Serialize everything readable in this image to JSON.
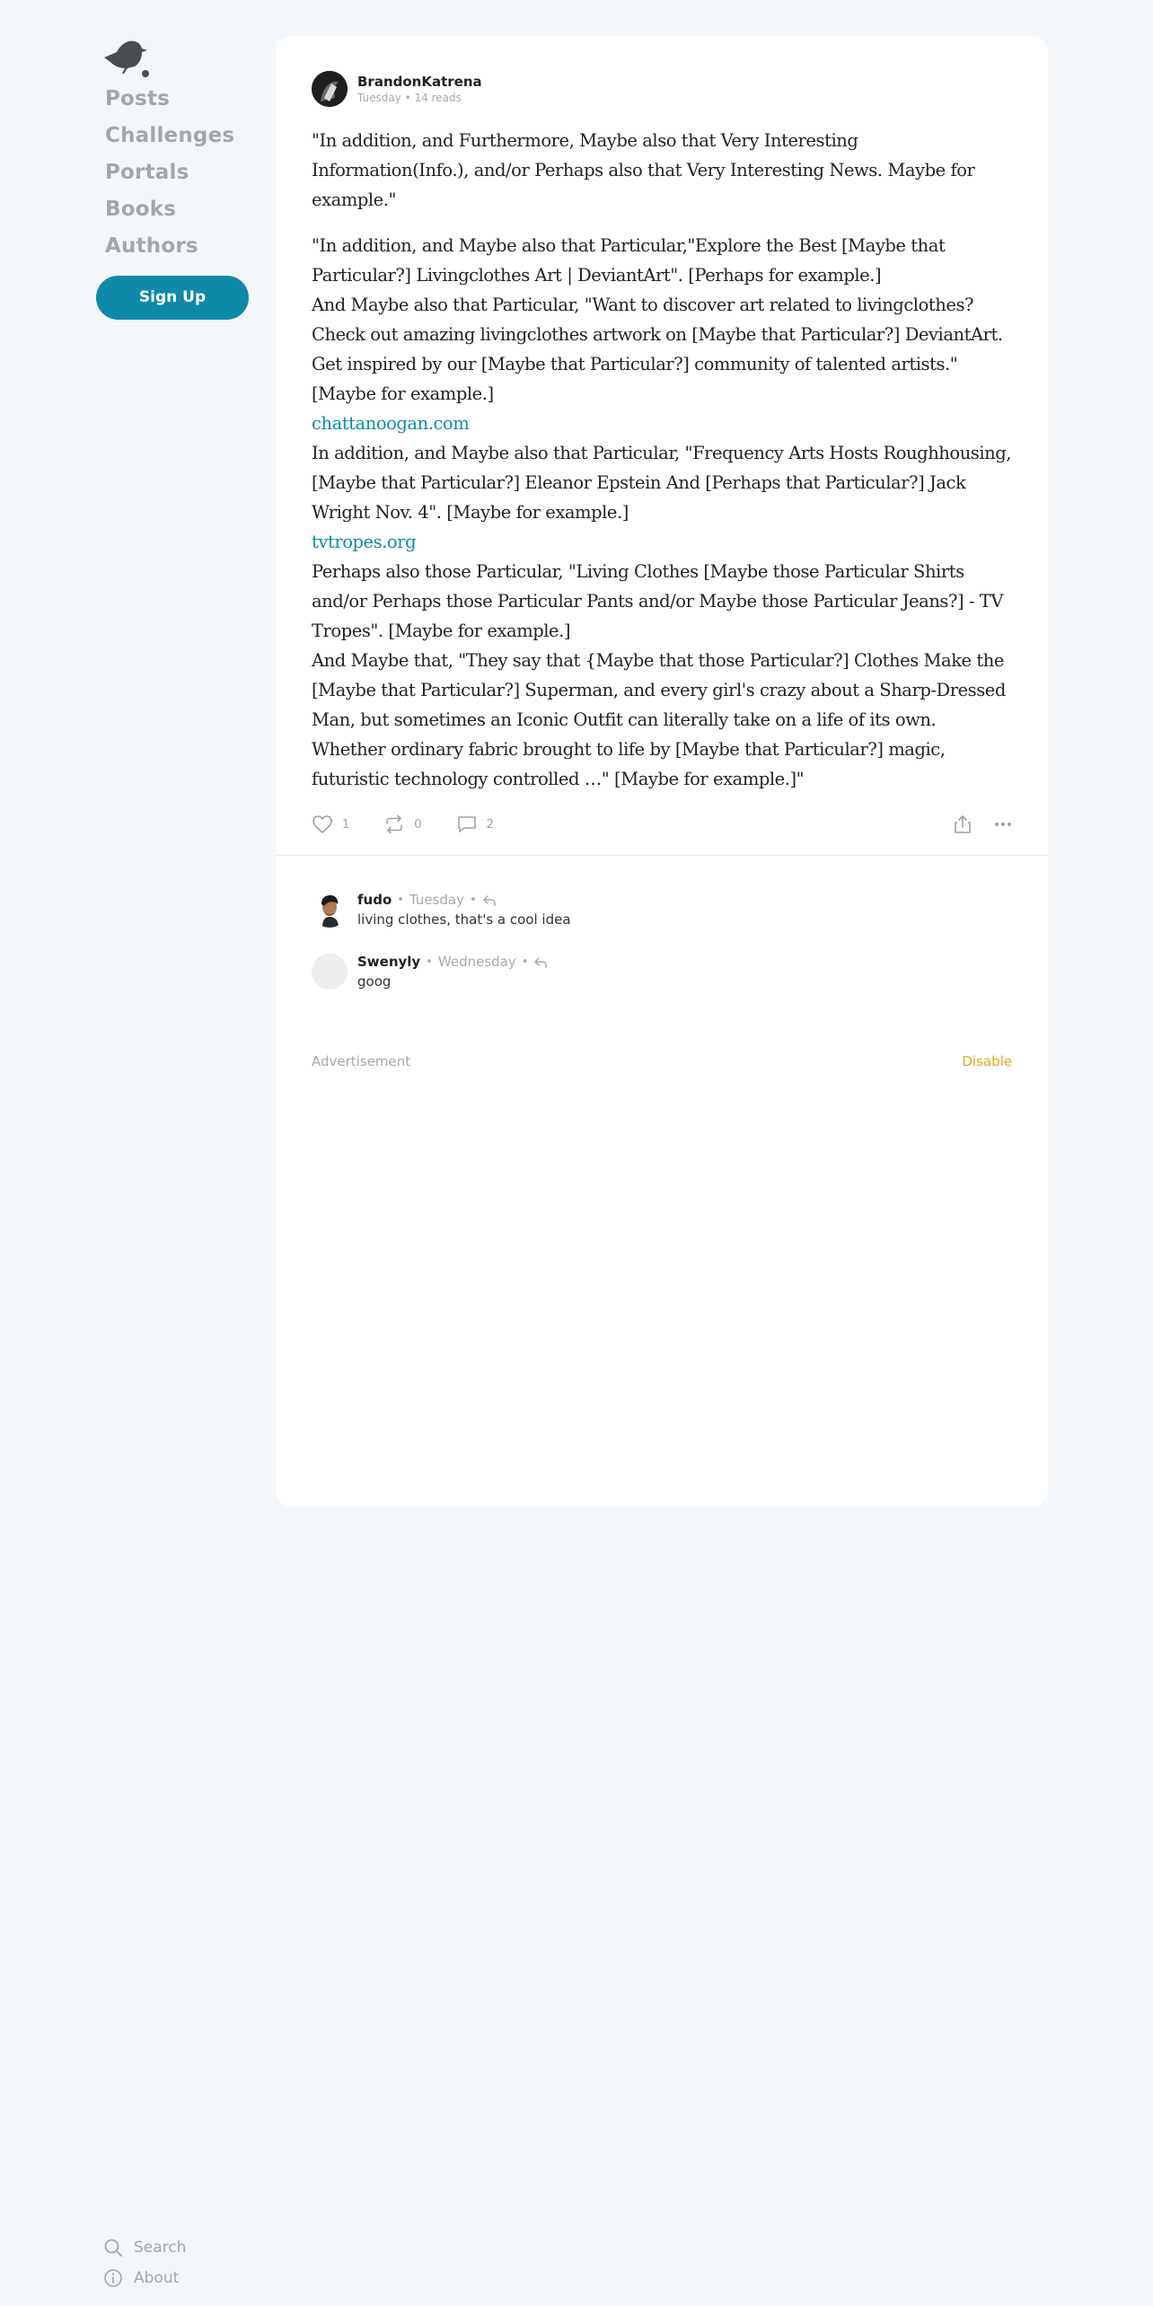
{
  "sidebar": {
    "logo": "bird-logo",
    "nav": [
      "Posts",
      "Challenges",
      "Portals",
      "Books",
      "Authors"
    ],
    "signup_label": "Sign Up",
    "bottom": [
      {
        "icon": "search-icon",
        "label": "Search"
      },
      {
        "icon": "info-icon",
        "label": "About"
      }
    ]
  },
  "post": {
    "author": "BrandonKatrena",
    "meta": "Tuesday • 14 reads",
    "paragraphs": [
      "\"In addition, and Furthermore, Maybe also that Very Interesting Information(Info.), and/or Perhaps also that Very Interesting News. Maybe for example.\"",
      "\"In addition, and Maybe also that Particular,\"Explore the Best [Maybe that Particular?] Livingclothes Art | DeviantArt\". [Perhaps for example.]",
      "And Maybe also that Particular, \"Want to discover art related to livingclothes? Check out amazing livingclothes artwork on [Maybe that Particular?] DeviantArt. Get inspired by our [Maybe that Particular?] community of talented artists.\" [Maybe for example.]",
      "chattanoogan.com",
      "In addition, and Maybe also that Particular, \"Frequency Arts Hosts Roughhousing, [Maybe that Particular?] Eleanor Epstein And [Perhaps that Particular?] Jack Wright Nov. 4\". [Maybe for example.]",
      "tvtropes.org",
      "Perhaps also those Particular, \"Living Clothes [Maybe those Particular Shirts and/or Perhaps those Particular Pants and/or Maybe those Particular Jeans?] - TV Tropes\". [Maybe for example.]",
      "And Maybe that, \"They say that {Maybe that those Particular?] Clothes Make the [Maybe that Particular?] Superman, and every girl's crazy about a Sharp-Dressed Man, but sometimes an Iconic Outfit can literally take on a life of its own. Whether ordinary fabric brought to life by [Maybe that Particular?] magic, futuristic technology controlled …\" [Maybe for example.]\""
    ],
    "likes": "1",
    "reposts": "0",
    "comments": "2"
  },
  "comments": [
    {
      "name": "fudo",
      "time": "Tuesday",
      "text": "living clothes, that's a cool idea"
    },
    {
      "name": "Swenyly",
      "time": "Wednesday",
      "text": "goog"
    }
  ],
  "ad": {
    "label": "Advertisement",
    "disable": "Disable"
  },
  "colors": {
    "accent": "#0e8aa8",
    "disable": "#e5a51e",
    "background": "#f3f7fa"
  }
}
